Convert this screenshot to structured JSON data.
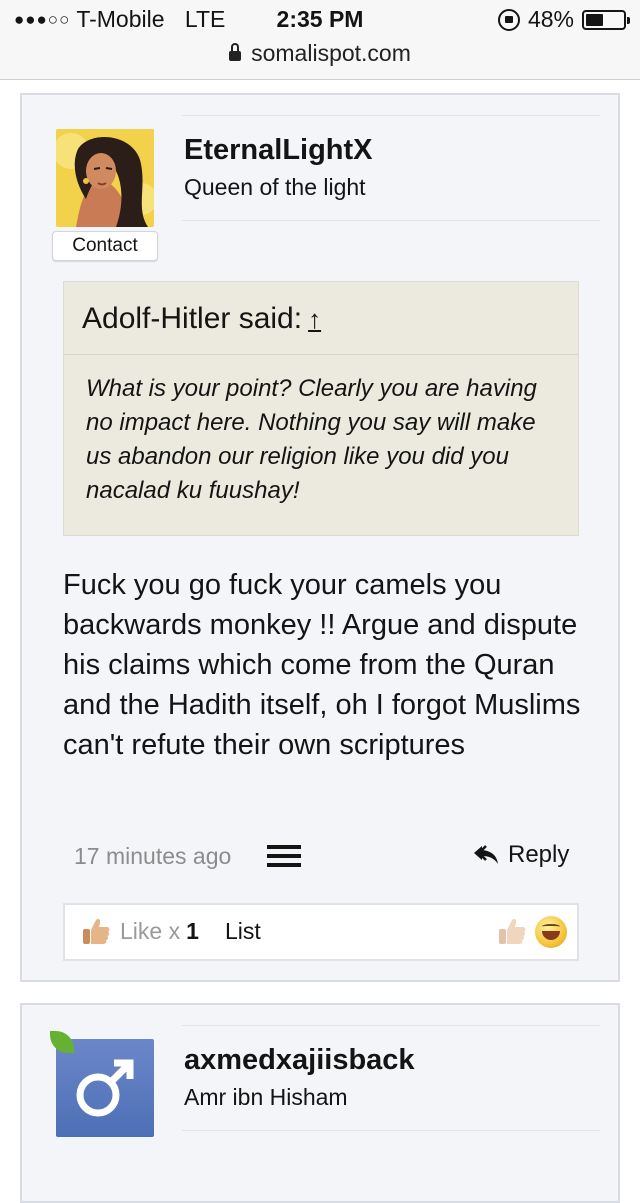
{
  "status_bar": {
    "carrier": "T-Mobile",
    "network": "LTE",
    "time": "2:35 PM",
    "battery_percent": "48%",
    "battery_level": 0.48,
    "signal_dots": "●●●○○"
  },
  "browser": {
    "url": "somalispot.com"
  },
  "post": {
    "username": "EternalLightX",
    "user_title": "Queen of the light",
    "contact_label": "Contact",
    "quote": {
      "author_line": "Adolf-Hitler said:",
      "arrow": "↑",
      "text": "What is your point? Clearly you are having no impact here. Nothing you say will make us abandon our religion like you did you nacalad ku fuushay!"
    },
    "message": "Fuck you go fuck your camels you backwards monkey !! Argue and dispute his claims which come from the Quran and the Hadith itself, oh I forgot Muslims can't refute their own scriptures",
    "time_ago": "17 minutes ago",
    "reply_label": "Reply",
    "likes": {
      "label": "Like x",
      "count": "1",
      "list_label": "List"
    }
  },
  "next_post": {
    "username": "axmedxajiisback",
    "user_title": "Amr ibn Hisham",
    "avatar_symbol": "♂"
  },
  "colors": {
    "card_bg": "#f4f5f9",
    "quote_bg": "#eceadf",
    "muted_text": "#8c8c8c"
  }
}
